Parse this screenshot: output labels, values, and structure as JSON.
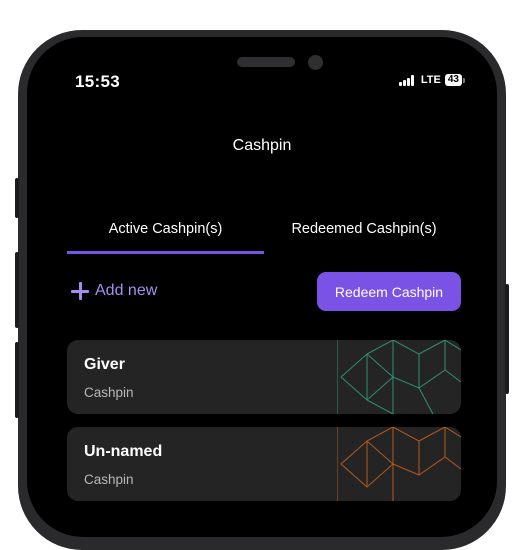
{
  "status_bar": {
    "time": "15:53",
    "network": "LTE",
    "battery": "43"
  },
  "header": {
    "title": "Cashpin"
  },
  "tabs": [
    {
      "label": "Active Cashpin(s)",
      "active": true
    },
    {
      "label": "Redeemed Cashpin(s)",
      "active": false
    }
  ],
  "actions": {
    "add_new": "Add new",
    "redeem": "Redeem Cashpin"
  },
  "cards": [
    {
      "name": "Giver",
      "subtitle": "Cashpin",
      "pattern_color": "#2f8f73",
      "pattern_icon": "isometric-cube-pattern"
    },
    {
      "name": "Un-named",
      "subtitle": "Cashpin",
      "pattern_color": "#b35a1f",
      "pattern_icon": "isometric-cube-pattern"
    }
  ],
  "colors": {
    "accent": "#7b52e6",
    "background": "#000000",
    "card": "#242424"
  }
}
